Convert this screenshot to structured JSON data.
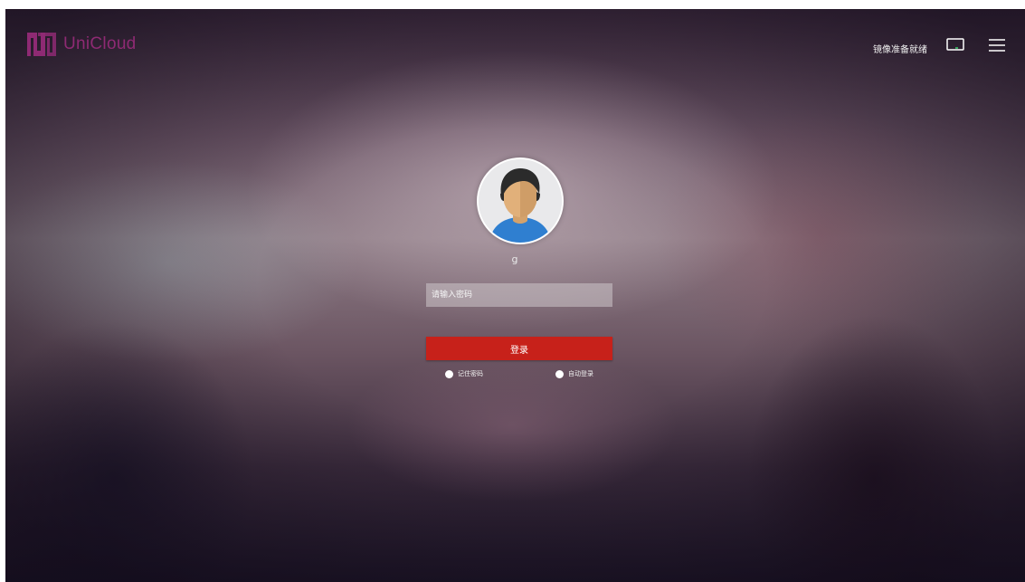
{
  "brand": {
    "name": "UniCloud",
    "color": "#8e2a73"
  },
  "header": {
    "status_text": "镜像准备就绪",
    "icons": [
      "monitor-icon",
      "menu-icon"
    ]
  },
  "login": {
    "username": "g",
    "password_placeholder": "请输入密码",
    "login_label": "登录",
    "remember_label": "记住密码",
    "auto_login_label": "自动登录",
    "accent_color": "#c7211a"
  }
}
